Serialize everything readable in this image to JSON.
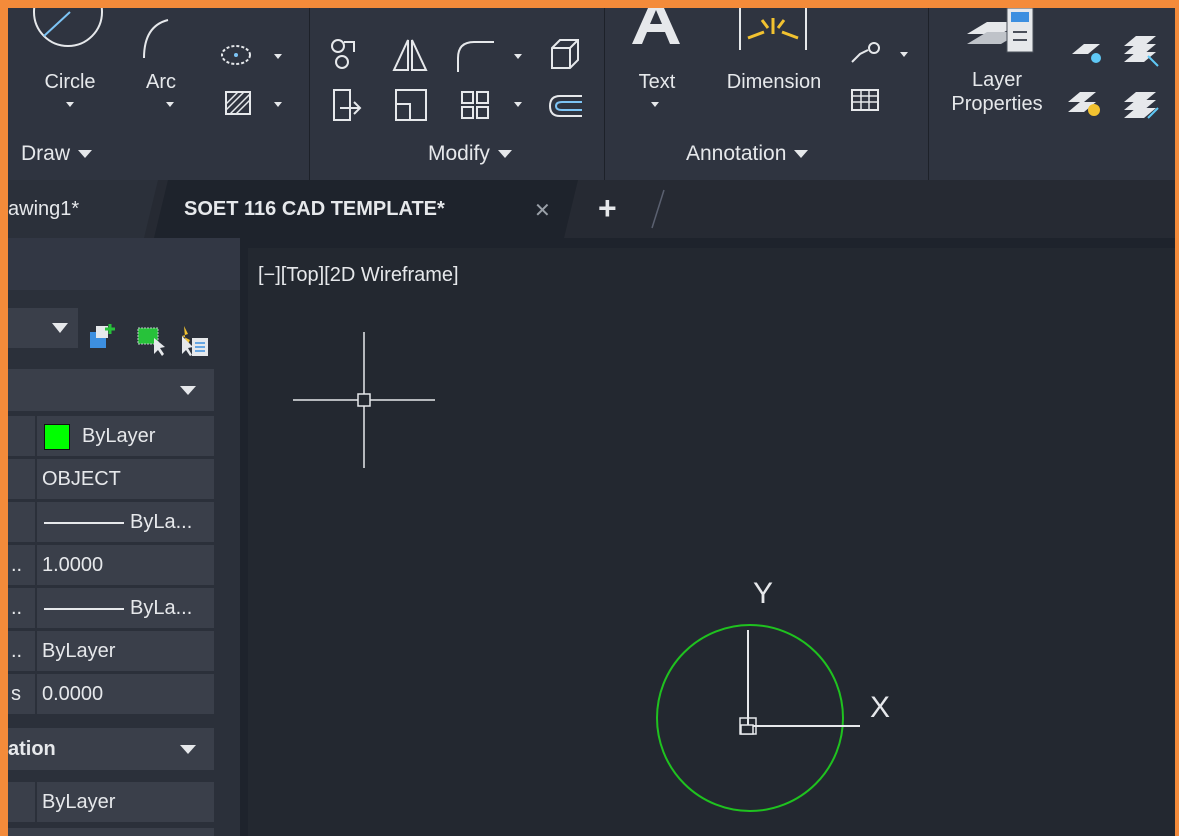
{
  "ribbon": {
    "draw": {
      "label": "Draw",
      "circle": "Circle",
      "arc": "Arc"
    },
    "modify": {
      "label": "Modify"
    },
    "annotation": {
      "label": "Annotation",
      "text": "Text",
      "dimension": "Dimension"
    },
    "layers": {
      "layer_properties_line1": "Layer",
      "layer_properties_line2": "Properties"
    }
  },
  "tabs": [
    {
      "label": "awing1*",
      "active": false
    },
    {
      "label": "SOET 116 CAD TEMPLATE*",
      "active": true
    }
  ],
  "tab_controls": {
    "close": "✕",
    "new": "+"
  },
  "viewport": {
    "label": "[−][Top][2D Wireframe]",
    "ucs_x": "X",
    "ucs_y": "Y"
  },
  "properties": {
    "section_general_rows": [
      {
        "left": "",
        "value": "ByLayer",
        "swatch": "#00ff00"
      },
      {
        "left": "",
        "value": "OBJECT"
      },
      {
        "left": "",
        "value": "ByLa...",
        "linetype": true
      },
      {
        "left": "..",
        "value": "1.0000"
      },
      {
        "left": "..",
        "value": "ByLa...",
        "linetype": true
      },
      {
        "left": "..",
        "value": "ByLayer"
      },
      {
        "left": "s",
        "value": "0.0000"
      }
    ],
    "section_3d": {
      "title": "ation"
    },
    "section_3d_rows": [
      {
        "left": "",
        "value": "ByLayer"
      }
    ]
  },
  "colors": {
    "accent_border": "#f48b3a",
    "circle": "#1fc21f",
    "swatch_green": "#00ff00"
  }
}
